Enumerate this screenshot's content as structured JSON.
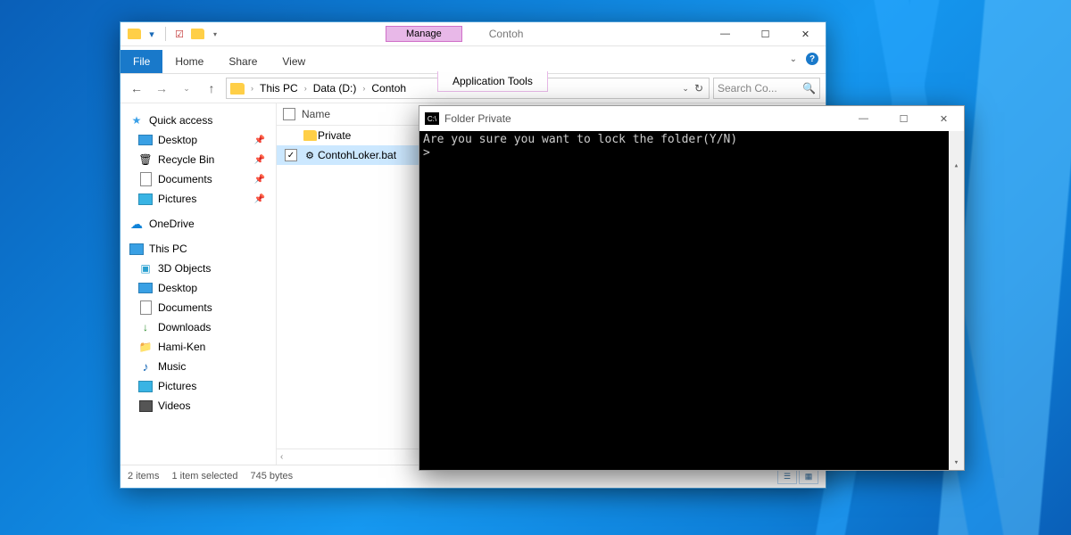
{
  "explorer": {
    "title": "Contoh",
    "ribbon_context": "Manage",
    "ribbon_context_sub": "Application Tools",
    "tabs": {
      "file": "File",
      "home": "Home",
      "share": "Share",
      "view": "View"
    },
    "address": {
      "root": "This PC",
      "drive": "Data (D:)",
      "folder": "Contoh"
    },
    "search_placeholder": "Search Co...",
    "columns": {
      "name": "Name"
    },
    "files": [
      {
        "name": "Private",
        "type": "folder",
        "selected": false
      },
      {
        "name": "ContohLoker.bat",
        "type": "bat",
        "selected": true
      }
    ],
    "nav": {
      "quick": {
        "label": "Quick access",
        "items": [
          {
            "label": "Desktop",
            "icon": "desktop",
            "pinned": true
          },
          {
            "label": "Recycle Bin",
            "icon": "recycle",
            "pinned": true
          },
          {
            "label": "Documents",
            "icon": "doc",
            "pinned": true
          },
          {
            "label": "Pictures",
            "icon": "pic",
            "pinned": true
          }
        ]
      },
      "onedrive": {
        "label": "OneDrive"
      },
      "thispc": {
        "label": "This PC",
        "items": [
          {
            "label": "3D Objects",
            "icon": "3d"
          },
          {
            "label": "Desktop",
            "icon": "desktop"
          },
          {
            "label": "Documents",
            "icon": "doc"
          },
          {
            "label": "Downloads",
            "icon": "down"
          },
          {
            "label": "Hami-Ken",
            "icon": "doc"
          },
          {
            "label": "Music",
            "icon": "music"
          },
          {
            "label": "Pictures",
            "icon": "pic"
          },
          {
            "label": "Videos",
            "icon": "vid"
          }
        ]
      }
    },
    "status": {
      "count": "2 items",
      "selected": "1 item selected",
      "size": "745 bytes"
    }
  },
  "cmd": {
    "title": "Folder Private",
    "line1": "Are you sure you want to lock the folder(Y/N)",
    "line2": ">"
  }
}
